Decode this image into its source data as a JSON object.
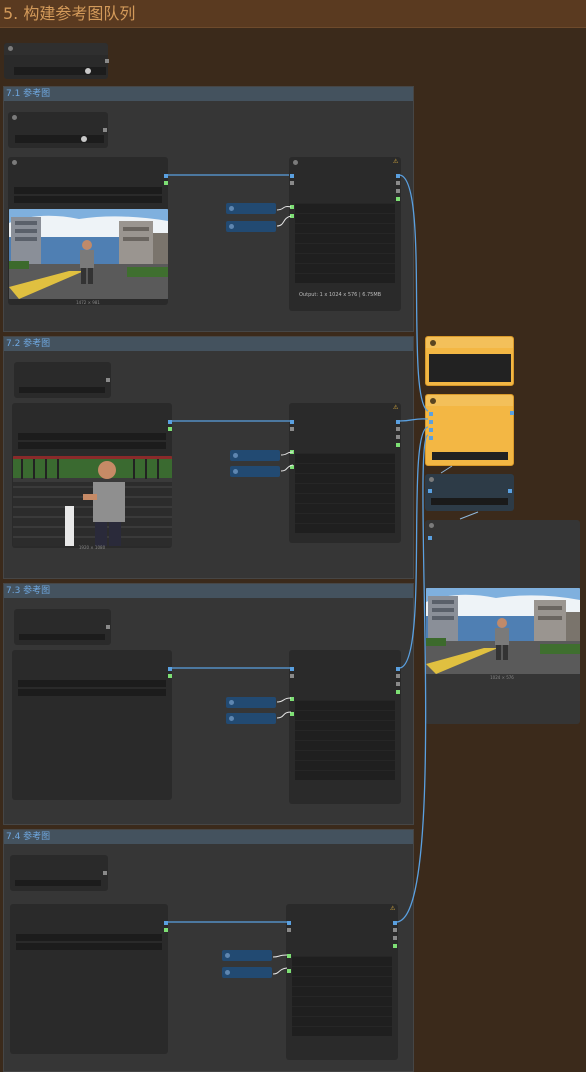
{
  "page": {
    "title": "5. 构建参考图队列"
  },
  "groups": [
    {
      "title": "7.1 参考图"
    },
    {
      "title": "7.2 参考图"
    },
    {
      "title": "7.3 参考图"
    },
    {
      "title": "7.4 参考图"
    }
  ],
  "captions": {
    "g1_image": "1472 × 981",
    "g2_image": "1920 × 1080",
    "preview_image": "1024 × 576"
  },
  "output_text": "Output: 1 x 1024 x 576 | 6.75MB",
  "colors": {
    "background": "#3b2a1b",
    "title_bar": "#5a3a20",
    "title_text": "#d39a5a",
    "group_header": "#44525e",
    "group_title": "#6fa8e0",
    "link_blue": "#5aa0e0",
    "slot_green": "#7ddf74",
    "orange_node": "#f3b744"
  },
  "icons": {
    "warning": "warning-icon",
    "node_collapse": "node-dot-icon"
  }
}
